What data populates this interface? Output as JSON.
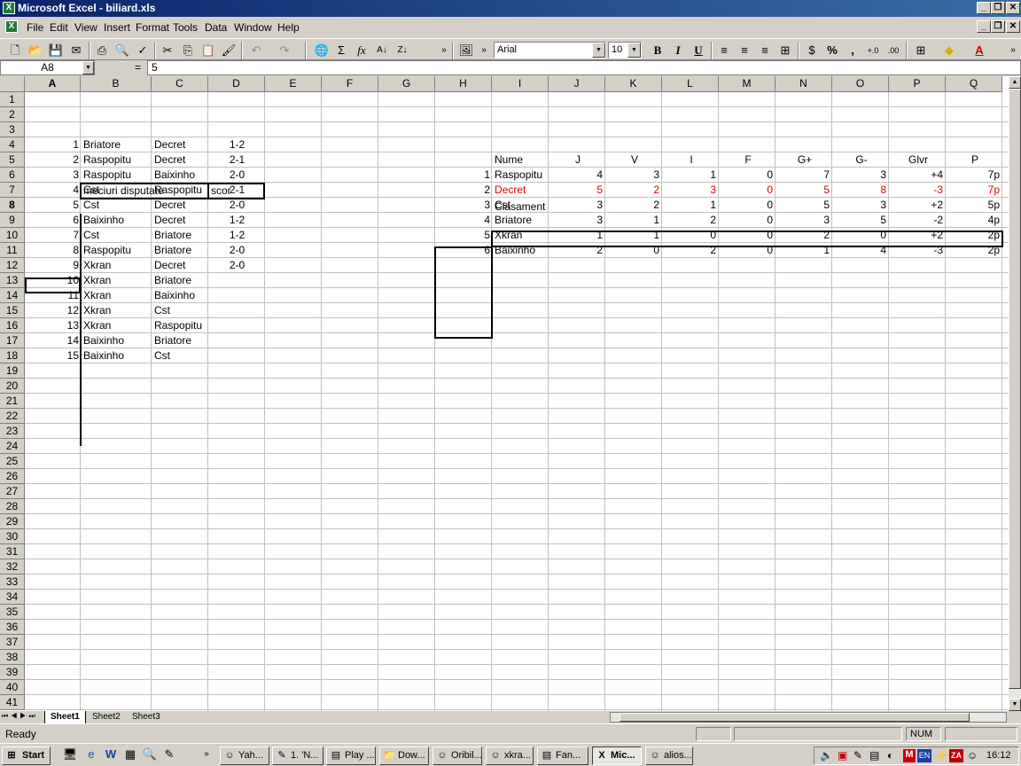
{
  "window": {
    "title": "Microsoft Excel - biliard.xls"
  },
  "menu": [
    "File",
    "Edit",
    "View",
    "Insert",
    "Format",
    "Tools",
    "Data",
    "Window",
    "Help"
  ],
  "toolbar": {
    "font": "Arial",
    "size": "10",
    "bold": "B",
    "italic": "I",
    "underline": "U",
    "sigma": "Σ",
    "fx": "fx",
    "percent": "%",
    "comma": ","
  },
  "formula_bar": {
    "cell_ref": "A8",
    "equals": "=",
    "value": "5"
  },
  "columns": [
    "A",
    "B",
    "C",
    "D",
    "E",
    "F",
    "G",
    "H",
    "I",
    "J",
    "K",
    "L",
    "M",
    "N",
    "O",
    "P",
    "Q"
  ],
  "rows": [
    "1",
    "2",
    "3",
    "4",
    "5",
    "6",
    "7",
    "8",
    "9",
    "10",
    "11",
    "12",
    "13",
    "14",
    "15",
    "16",
    "17",
    "18",
    "19",
    "20",
    "21",
    "22",
    "23",
    "24",
    "25",
    "26",
    "27",
    "28",
    "29",
    "30",
    "31",
    "32",
    "33",
    "34",
    "35",
    "36",
    "37",
    "38",
    "39",
    "40",
    "41"
  ],
  "matches": {
    "header_b": "meciuri disputate",
    "header_d": "scor",
    "rows": [
      {
        "n": "1",
        "t1": "Briatore",
        "t2": "Decret",
        "score": "1-2"
      },
      {
        "n": "2",
        "t1": "Raspopitu",
        "t2": "Decret",
        "score": "2-1"
      },
      {
        "n": "3",
        "t1": "Raspopitu",
        "t2": "Baixinho",
        "score": "2-0"
      },
      {
        "n": "4",
        "t1": "Cst",
        "t2": "Raspopitu",
        "score": "2-1"
      },
      {
        "n": "5",
        "t1": "Cst",
        "t2": "Decret",
        "score": "2-0"
      },
      {
        "n": "6",
        "t1": "Baixinho",
        "t2": "Decret",
        "score": "1-2"
      },
      {
        "n": "7",
        "t1": "Cst",
        "t2": "Briatore",
        "score": "1-2"
      },
      {
        "n": "8",
        "t1": "Raspopitu",
        "t2": "Briatore",
        "score": "2-0"
      },
      {
        "n": "9",
        "t1": "Xkran",
        "t2": "Decret",
        "score": "2-0"
      },
      {
        "n": "10",
        "t1": "Xkran",
        "t2": "Briatore",
        "score": ""
      },
      {
        "n": "11",
        "t1": "Xkran",
        "t2": "Baixinho",
        "score": ""
      },
      {
        "n": "12",
        "t1": "Xkran",
        "t2": "Cst",
        "score": ""
      },
      {
        "n": "13",
        "t1": "Xkran",
        "t2": "Raspopitu",
        "score": ""
      },
      {
        "n": "14",
        "t1": "Baixinho",
        "t2": "Briatore",
        "score": ""
      },
      {
        "n": "15",
        "t1": "Baixinho",
        "t2": "Cst",
        "score": ""
      }
    ]
  },
  "standings": {
    "title": "Clasament",
    "headers": [
      "Nume",
      "J",
      "V",
      "I",
      "F",
      "G+",
      "G-",
      "Glvr",
      "P"
    ],
    "rows": [
      {
        "rank": "1",
        "cells": [
          "Raspopitu",
          "4",
          "3",
          "1",
          "0",
          "7",
          "3",
          "+4",
          "7p"
        ],
        "highlight": false
      },
      {
        "rank": "2",
        "cells": [
          "Decret",
          "5",
          "2",
          "3",
          "0",
          "5",
          "8",
          "-3",
          "7p"
        ],
        "highlight": true
      },
      {
        "rank": "3",
        "cells": [
          "Cst",
          "3",
          "2",
          "1",
          "0",
          "5",
          "3",
          "+2",
          "5p"
        ],
        "highlight": false
      },
      {
        "rank": "4",
        "cells": [
          "Briatore",
          "3",
          "1",
          "2",
          "0",
          "3",
          "5",
          "-2",
          "4p"
        ],
        "highlight": false
      },
      {
        "rank": "5",
        "cells": [
          "Xkran",
          "1",
          "1",
          "0",
          "0",
          "2",
          "0",
          "+2",
          "2p"
        ],
        "highlight": false
      },
      {
        "rank": "6",
        "cells": [
          "Baixinho",
          "2",
          "0",
          "2",
          "0",
          "1",
          "4",
          "-3",
          "2p"
        ],
        "highlight": false
      }
    ],
    "highlight_color": "#e00000"
  },
  "sheets": [
    "Sheet1",
    "Sheet2",
    "Sheet3"
  ],
  "status": {
    "ready": "Ready",
    "num": "NUM"
  },
  "taskbar": {
    "start": "Start",
    "tasks": [
      "Yah...",
      "1. 'N...",
      "Play ...",
      "Dow...",
      "Oribil...",
      "xkra...",
      "Fan...",
      "Mic...",
      "alios..."
    ],
    "lang": "EN",
    "clock": "16:12"
  }
}
